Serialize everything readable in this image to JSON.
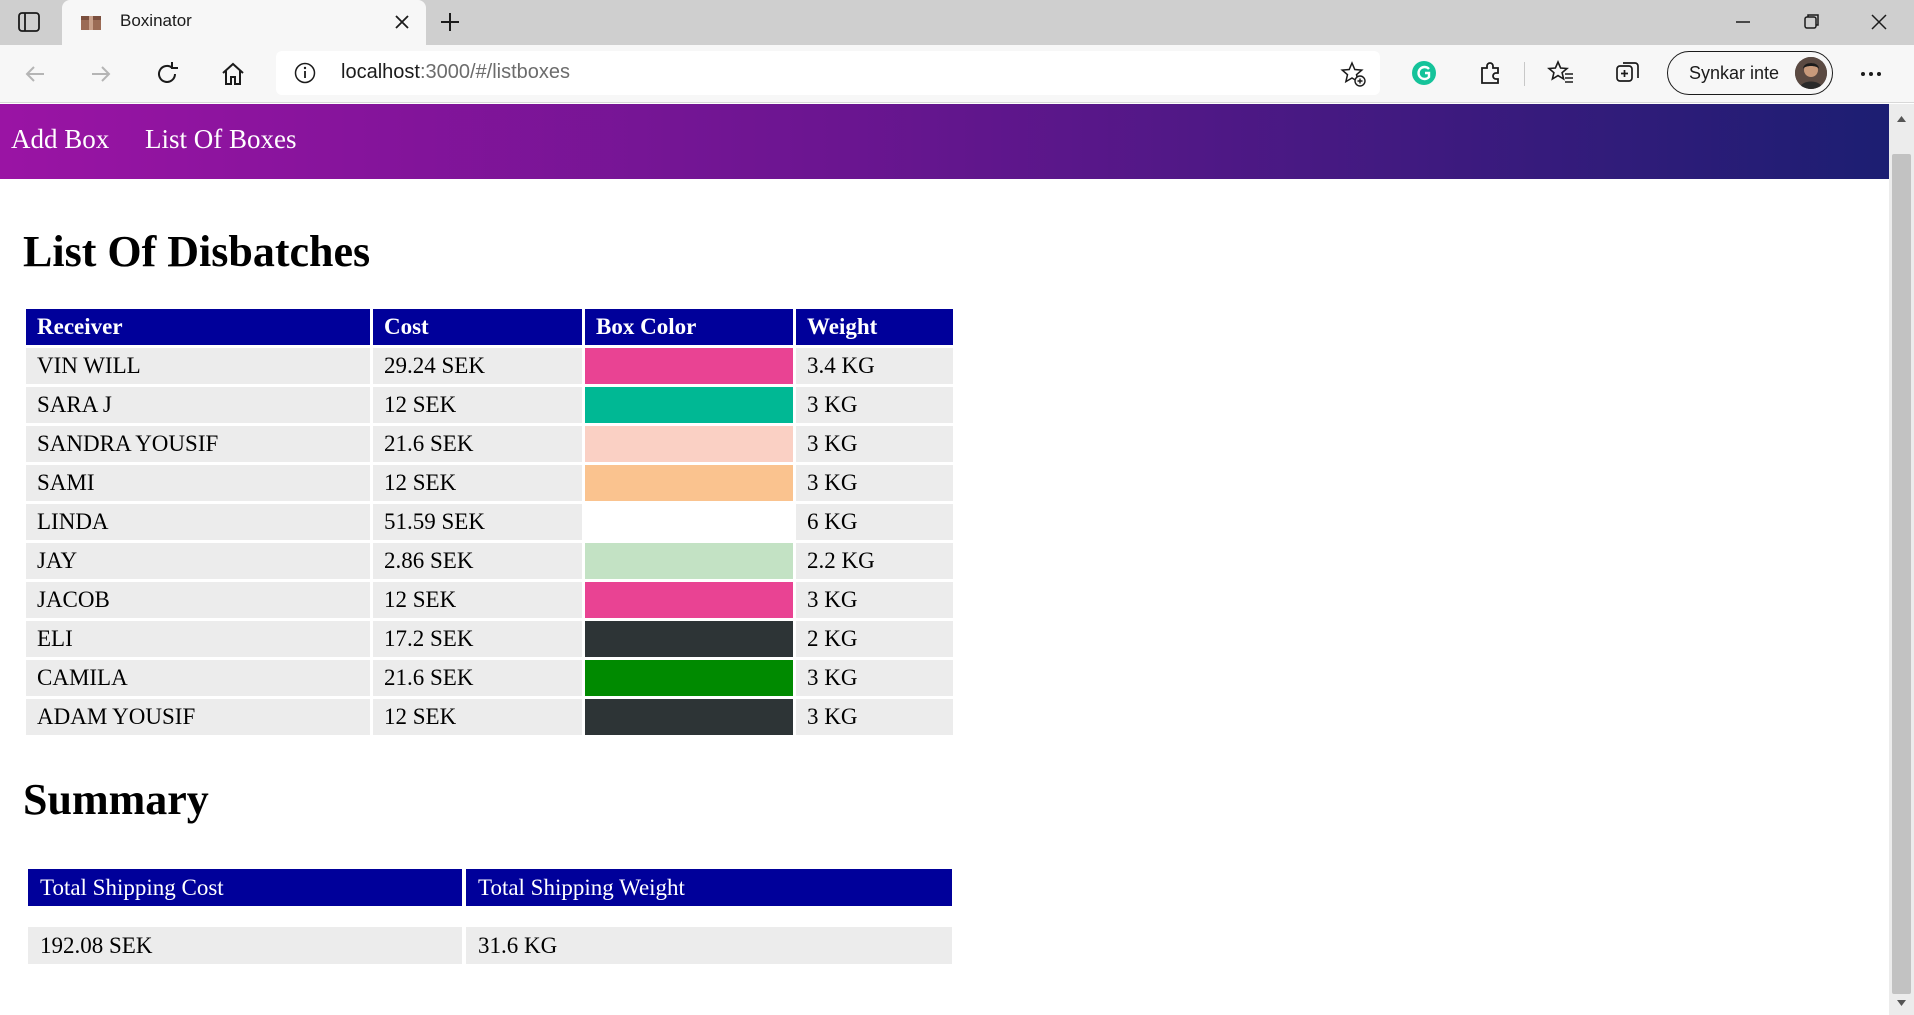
{
  "browser": {
    "tab_title": "Boxinator",
    "url_host": "localhost",
    "url_rest": ":3000/#/listboxes",
    "profile_label": "Synkar inte"
  },
  "nav": {
    "links": [
      "Add Box",
      "List Of Boxes"
    ],
    "gradient_colors": [
      "#9a14a4",
      "#1c1e72"
    ]
  },
  "list": {
    "heading": "List Of Disbatches",
    "columns": [
      "Receiver",
      "Cost",
      "Box Color",
      "Weight"
    ],
    "rows": [
      {
        "receiver": "VIN WILL",
        "cost": "29.24 SEK",
        "color": "#e94393",
        "weight": "3.4 KG"
      },
      {
        "receiver": "SARA J",
        "cost": "12 SEK",
        "color": "#00b894",
        "weight": "3 KG"
      },
      {
        "receiver": "SANDRA YOUSIF",
        "cost": "21.6 SEK",
        "color": "#fad0c4",
        "weight": "3 KG"
      },
      {
        "receiver": "SAMI",
        "cost": "12 SEK",
        "color": "#fac38f",
        "weight": "3 KG"
      },
      {
        "receiver": "LINDA",
        "cost": "51.59 SEK",
        "color": "#ffffff",
        "weight": "6 KG"
      },
      {
        "receiver": "JAY",
        "cost": "2.86 SEK",
        "color": "#c3e2c4",
        "weight": "2.2 KG"
      },
      {
        "receiver": "JACOB",
        "cost": "12 SEK",
        "color": "#e94393",
        "weight": "3 KG"
      },
      {
        "receiver": "ELI",
        "cost": "17.2 SEK",
        "color": "#2d3436",
        "weight": "2 KG"
      },
      {
        "receiver": "CAMILA",
        "cost": "21.6 SEK",
        "color": "#008a00",
        "weight": "3 KG"
      },
      {
        "receiver": "ADAM YOUSIF",
        "cost": "12 SEK",
        "color": "#2d3436",
        "weight": "3 KG"
      }
    ]
  },
  "summary": {
    "heading": "Summary",
    "columns": [
      "Total Shipping Cost",
      "Total Shipping Weight"
    ],
    "values": [
      "192.08 SEK",
      "31.6 KG"
    ]
  },
  "colors": {
    "header_blue": "#00009a",
    "cell_gray": "#ececec"
  }
}
